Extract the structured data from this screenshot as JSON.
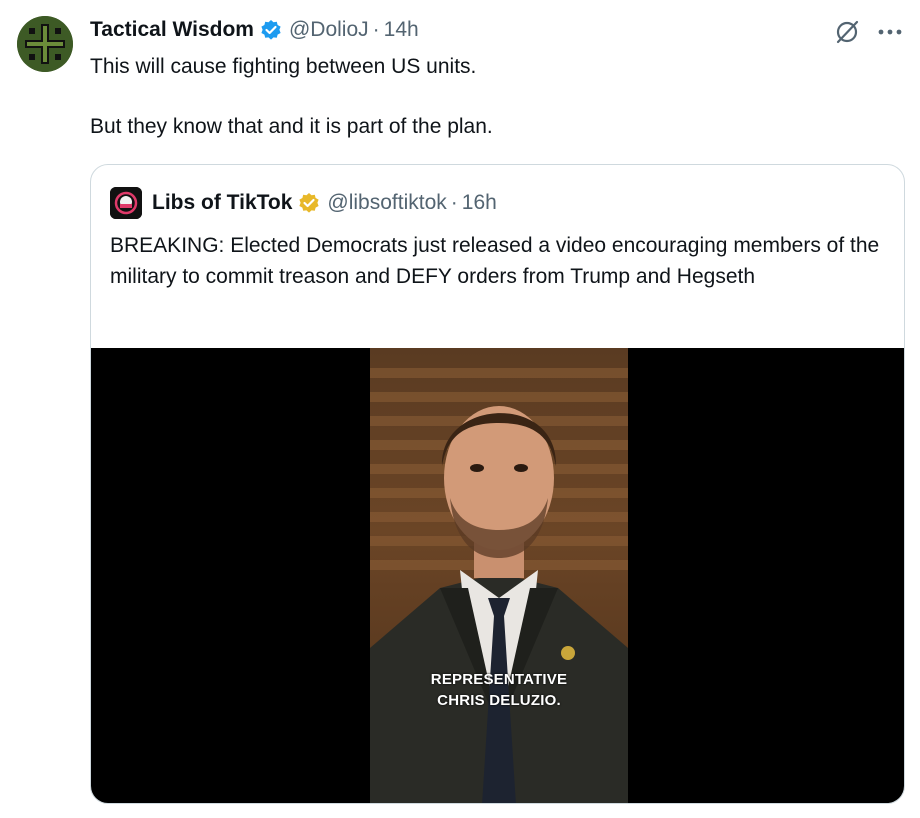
{
  "tweet": {
    "author_name": "Tactical Wisdom",
    "handle": "@DolioJ",
    "separator": "·",
    "time": "14h",
    "text_line1": "This will cause fighting between US units.",
    "text_line2": "But they know that and it is part of the plan.",
    "verified_color": "#1d9bf0",
    "icons": [
      "grok-icon",
      "more-icon"
    ]
  },
  "quote": {
    "author_name": "Libs of TikTok",
    "handle": "@libsoftiktok",
    "separator": "·",
    "time": "16h",
    "text": "BREAKING: Elected Democrats just released a video encouraging members of the military to commit treason and DEFY orders from Trump and Hegseth",
    "verified_color": "#e8b829",
    "video_caption_line1": "REPRESENTATIVE",
    "video_caption_line2": "CHRIS DELUZIO."
  }
}
